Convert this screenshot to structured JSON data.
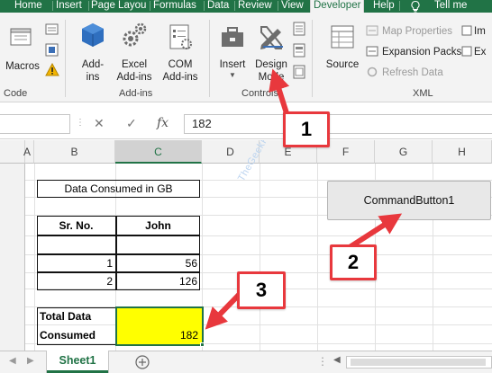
{
  "tabs": [
    "Home",
    "Insert",
    "Page Layou",
    "Formulas",
    "Data",
    "Review",
    "View",
    "Developer",
    "Help",
    "Tell me"
  ],
  "ribbon": {
    "code": {
      "label": "Code",
      "macros": "Macros"
    },
    "addins": {
      "label": "Add-ins",
      "addins_btn": [
        "Add-",
        "ins"
      ],
      "excel_addins": [
        "Excel",
        "Add-ins"
      ],
      "com_addins": [
        "COM",
        "Add-ins"
      ]
    },
    "controls": {
      "label": "Controls",
      "insert": "Insert",
      "design_mode": [
        "Design",
        "Mode"
      ]
    },
    "xml": {
      "label": "XML",
      "source": "Source",
      "map_properties": "Map Properties",
      "expansion_packs": "Expansion Packs",
      "refresh_data": "Refresh Data",
      "import_partial": "Im",
      "export_partial": "Ex"
    }
  },
  "formula_bar": {
    "cancel": "✕",
    "enter": "✓",
    "fx": "fx",
    "value": "182"
  },
  "grid": {
    "columns": [
      "A",
      "B",
      "C",
      "D",
      "E",
      "F",
      "G",
      "H"
    ],
    "selected_column": "C",
    "title": "Data Consumed in GB",
    "table": {
      "headers": [
        "Sr. No.",
        "John"
      ],
      "rows": [
        {
          "sr": "",
          "john": ""
        },
        {
          "sr": "1",
          "john": "56"
        },
        {
          "sr": "2",
          "john": "126"
        }
      ]
    },
    "total_label": [
      "Total Data",
      "Consumed"
    ],
    "total_value": "182",
    "command_button": "CommandButton1",
    "watermark": "TheGeekPage.com"
  },
  "callouts": [
    "1",
    "2",
    "3"
  ],
  "colors": {
    "excel_green": "#217346",
    "highlight": "#ffff00",
    "callout_red": "#e8383d"
  },
  "sheets": {
    "active": "Sheet1",
    "add_icon": "plus-circle-icon"
  }
}
